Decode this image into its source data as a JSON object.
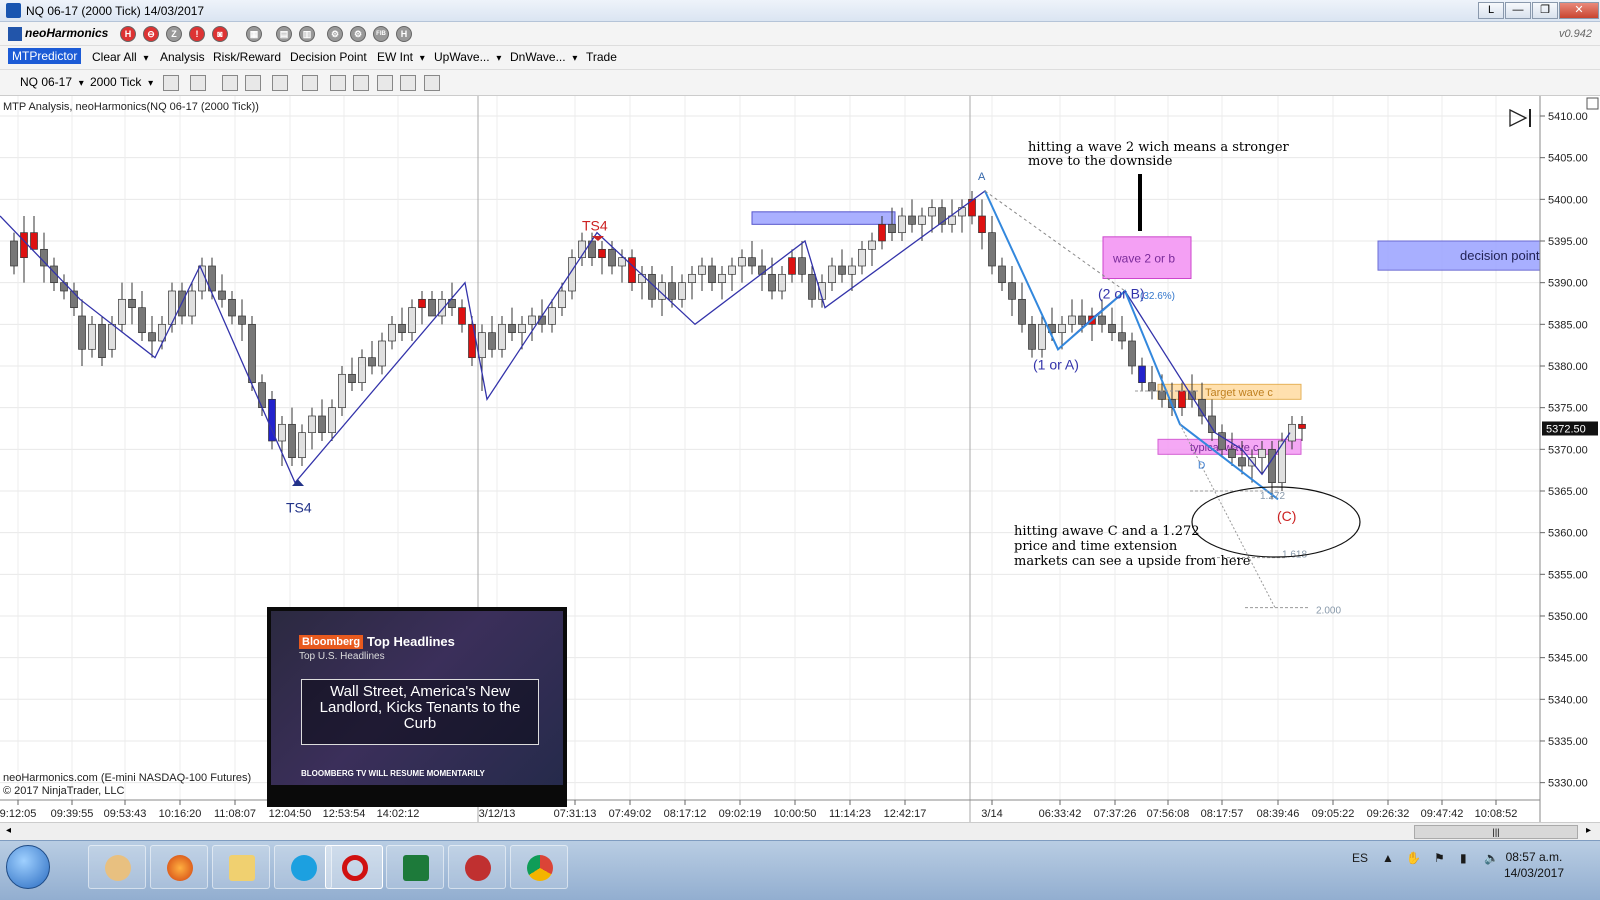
{
  "window": {
    "title": "NQ 06-17 (2000 Tick)  14/03/2017",
    "buttons": [
      "L",
      "—",
      "❐",
      "✕"
    ]
  },
  "toolbar1": {
    "brand": "neoHarmonics",
    "icons": [
      {
        "name": "h-red-icon",
        "label": "H"
      },
      {
        "name": "minus-red-icon",
        "label": "⊖"
      },
      {
        "name": "z-icon",
        "label": "Z"
      },
      {
        "name": "exclaim-red-icon",
        "label": "!"
      },
      {
        "name": "camera-icon",
        "label": "◙"
      },
      {
        "name": "grid-icon",
        "label": "▦"
      },
      {
        "name": "chart1-icon",
        "label": "▤"
      },
      {
        "name": "chart2-icon",
        "label": "▥"
      },
      {
        "name": "tools-icon",
        "label": "⚙"
      },
      {
        "name": "harm-icon",
        "label": "⚙"
      },
      {
        "name": "fib-icon",
        "label": "FIB"
      },
      {
        "name": "h-gray-icon",
        "label": "H"
      }
    ],
    "version": "v0.942"
  },
  "toolbar2": {
    "items": [
      {
        "label": "MTPredictor",
        "active": true,
        "dropdown": false
      },
      {
        "label": "Clear All",
        "active": false,
        "dropdown": true
      },
      {
        "label": "Analysis",
        "active": false,
        "dropdown": false
      },
      {
        "label": "Risk/Reward",
        "active": false,
        "dropdown": false
      },
      {
        "label": "Decision Point",
        "active": false,
        "dropdown": false
      },
      {
        "label": "EW Int",
        "active": false,
        "dropdown": true
      },
      {
        "label": "UpWave...",
        "active": false,
        "dropdown": true
      },
      {
        "label": "DnWave...",
        "active": false,
        "dropdown": true
      },
      {
        "label": "Trade",
        "active": false,
        "dropdown": false
      }
    ]
  },
  "toolbar3": {
    "instrument": "NQ 06-17",
    "interval": "2000 Tick"
  },
  "chart": {
    "header": "MTP Analysis, neoHarmonics(NQ 06-17 (2000 Tick))",
    "footer_left": "neoHarmonics.com (E-mini NASDAQ-100 Futures)",
    "copyright": "© 2017 NinjaTrader, LLC",
    "y_ticks": [
      "5410.00",
      "5405.00",
      "5400.00",
      "5395.00",
      "5390.00",
      "5385.00",
      "5380.00",
      "5375.00",
      "5370.00",
      "5365.00",
      "5360.00",
      "5355.00",
      "5350.00",
      "5345.00",
      "5340.00",
      "5335.00",
      "5330.00"
    ],
    "x_ticks": [
      "9:12:05",
      "09:39:55",
      "09:53:43",
      "10:16:20",
      "11:08:07",
      "12:04:50",
      "12:53:54",
      "14:02:12",
      "3/12/13",
      "07:31:13",
      "07:49:02",
      "08:17:12",
      "09:02:19",
      "10:00:50",
      "11:14:23",
      "12:42:17",
      "3/14",
      "06:33:42",
      "07:37:26",
      "07:56:08",
      "08:17:57",
      "08:39:46",
      "09:05:22",
      "09:26:32",
      "09:47:42",
      "10:08:52"
    ],
    "last_price": "5372.50",
    "labels": {
      "ts4_top": "TS4",
      "ts4_bottom": "TS4",
      "wave_a": "A",
      "wave_1a": "(1 or A)",
      "wave_2b": "(2 or B)",
      "retrace": "(32.6%)",
      "wave_c": "(C)",
      "wave2_box": "wave 2 or b",
      "decision_box": "decision point",
      "targetc_box": "Target wave c",
      "typical_box": "typical wave c",
      "d_label": "D",
      "fib_1272": "1.272",
      "fib_1618": "1.618",
      "fib_2000": "2.000"
    },
    "annotations": {
      "top_line1": "hitting a wave 2 wich means a stronger",
      "top_line2": "move to the downside",
      "bottom_line1": "hitting awave C and a 1.272",
      "bottom_line2": "price and time extension",
      "bottom_line3": "markets can see a upside from here"
    }
  },
  "news": {
    "tag": "Bloomberg",
    "headline": "Top Headlines",
    "sub": "Top U.S. Headlines",
    "story": "Wall Street, America's New Landlord, Kicks Tenants to the Curb",
    "footer": "BLOOMBERG TV WILL RESUME MOMENTARILY"
  },
  "taskbar": {
    "apps": [
      "hand-app-icon",
      "firefox-icon",
      "folder-icon",
      "skype-icon",
      "opera-icon",
      "excel-icon",
      "ninjatrader-icon",
      "chrome-icon"
    ],
    "lang": "ES",
    "time": "08:57 a.m.",
    "date": "14/03/2017"
  },
  "colors": {
    "bull": "#c8c8c8",
    "bear": "#dd1111",
    "zigzag": "#3333aa",
    "accent": "#1c5bd6"
  }
}
